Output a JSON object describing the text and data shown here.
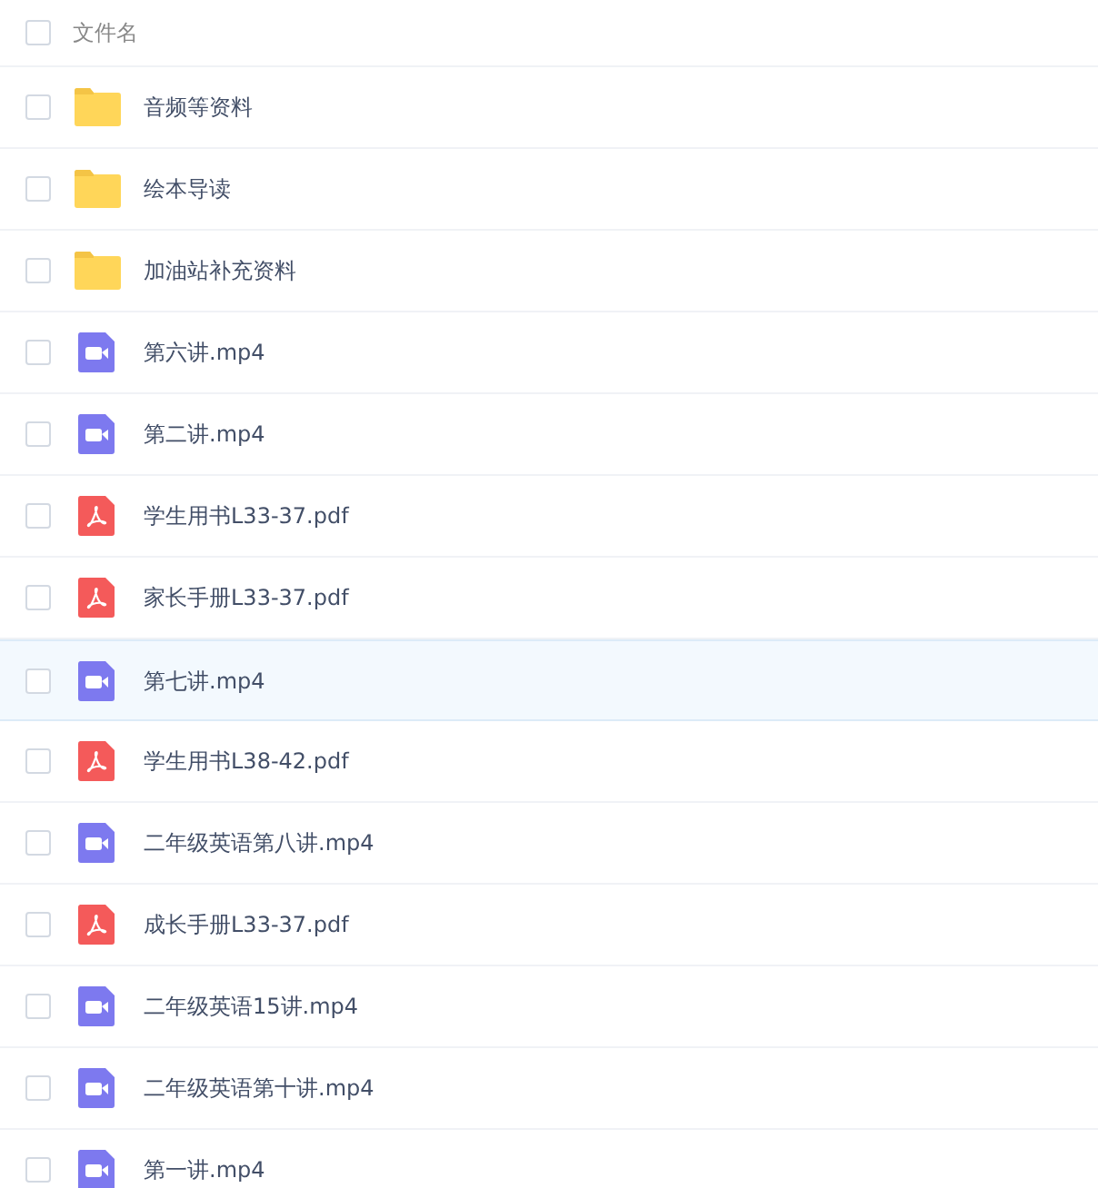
{
  "header": {
    "label": "文件名",
    "checked": false
  },
  "files": [
    {
      "kind": "folder",
      "name": "音频等资料",
      "checked": false,
      "hovered": false
    },
    {
      "kind": "folder",
      "name": "绘本导读",
      "checked": false,
      "hovered": false
    },
    {
      "kind": "folder",
      "name": "加油站补充资料",
      "checked": false,
      "hovered": false
    },
    {
      "kind": "video",
      "name": "第六讲.mp4",
      "checked": false,
      "hovered": false
    },
    {
      "kind": "video",
      "name": "第二讲.mp4",
      "checked": false,
      "hovered": false
    },
    {
      "kind": "pdf",
      "name": "学生用书L33-37.pdf",
      "checked": false,
      "hovered": false
    },
    {
      "kind": "pdf",
      "name": "家长手册L33-37.pdf",
      "checked": false,
      "hovered": false
    },
    {
      "kind": "video",
      "name": "第七讲.mp4",
      "checked": false,
      "hovered": true
    },
    {
      "kind": "pdf",
      "name": "学生用书L38-42.pdf",
      "checked": false,
      "hovered": false
    },
    {
      "kind": "video",
      "name": "二年级英语第八讲.mp4",
      "checked": false,
      "hovered": false
    },
    {
      "kind": "pdf",
      "name": "成长手册L33-37.pdf",
      "checked": false,
      "hovered": false
    },
    {
      "kind": "video",
      "name": "二年级英语15讲.mp4",
      "checked": false,
      "hovered": false
    },
    {
      "kind": "video",
      "name": "二年级英语第十讲.mp4",
      "checked": false,
      "hovered": false
    },
    {
      "kind": "video",
      "name": "第一讲.mp4",
      "checked": false,
      "hovered": false
    }
  ]
}
